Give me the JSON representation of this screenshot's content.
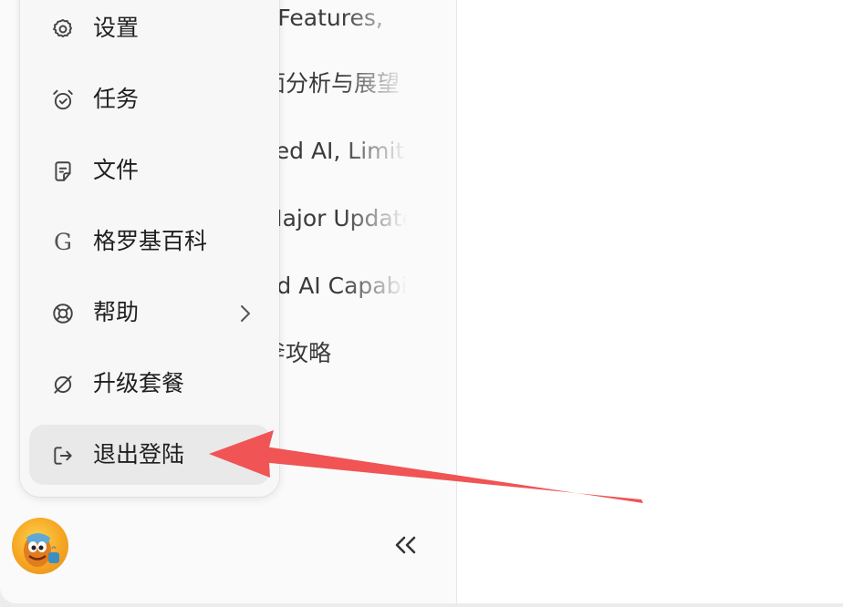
{
  "chat_list": [
    ": Features, ",
    "面分析与展望",
    "ced AI, Limits",
    "Major Update",
    "ed AI Capabilities",
    "斧攻略"
  ],
  "menu": {
    "items": [
      {
        "label": "设置",
        "icon": "gear-icon"
      },
      {
        "label": "任务",
        "icon": "alarm-clock-icon"
      },
      {
        "label": "文件",
        "icon": "note-icon"
      },
      {
        "label": "格罗基百科",
        "icon": "grokipedia-g-icon",
        "icon_text": "G"
      },
      {
        "label": "帮助",
        "icon": "lifebuoy-icon",
        "has_submenu": true
      },
      {
        "label": "升级套餐",
        "icon": "upgrade-slash-icon"
      },
      {
        "label": "退出登陆",
        "icon": "logout-icon",
        "highlighted": true
      }
    ]
  },
  "annotation": {
    "color": "#f05454",
    "type": "arrow",
    "points_to": "退出登陆"
  }
}
